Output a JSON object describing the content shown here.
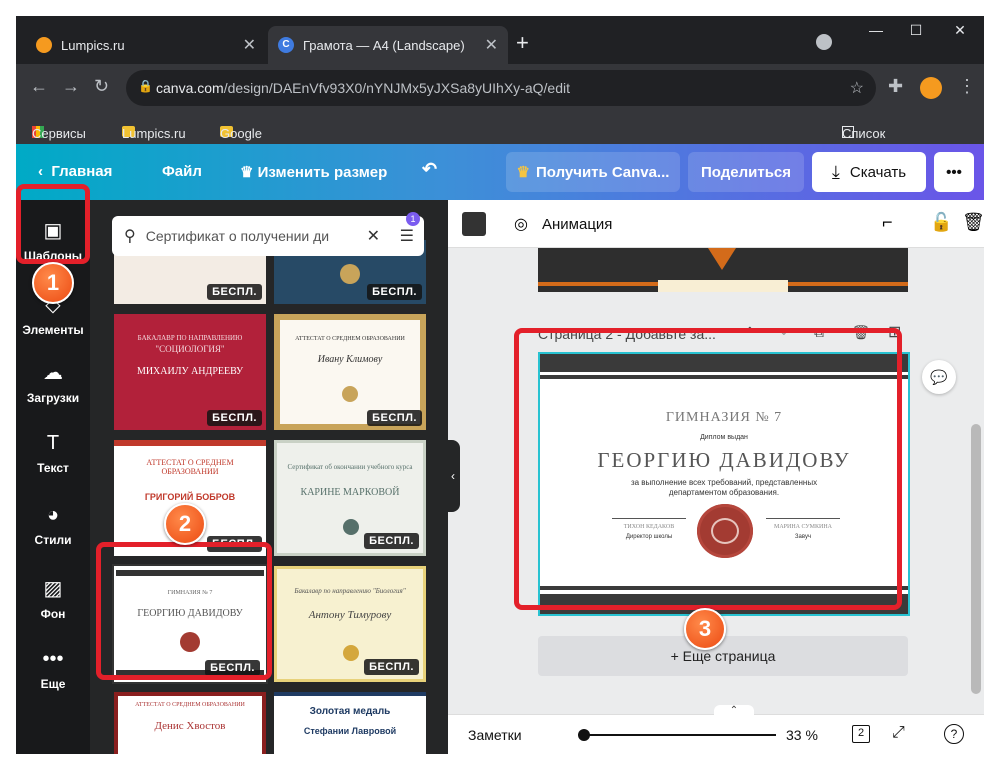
{
  "browser": {
    "tabs": [
      {
        "title": "Lumpics.ru"
      },
      {
        "title": "Грамота — A4 (Landscape)"
      }
    ],
    "new_tab": "+",
    "url_domain": "canva.com",
    "url_path": "/design/DAEnVfv93X0/nYNJMx5yJXSa8yUIhXy-aQ/edit",
    "bookmarks": [
      "Сервисы",
      "Lumpics.ru",
      "Google"
    ],
    "reading_list": "Список для чтения"
  },
  "topbar": {
    "home": "Главная",
    "file": "Файл",
    "resize": "Изменить размер",
    "get_pro": "Получить Canva...",
    "share": "Поделиться",
    "download": "Скачать",
    "more": "•••"
  },
  "sidebar": {
    "items": [
      {
        "label": "Шаблоны"
      },
      {
        "label": "Элементы"
      },
      {
        "label": "Загрузки"
      },
      {
        "label": "Текст"
      },
      {
        "label": "Стили"
      },
      {
        "label": "Фон"
      },
      {
        "label": "Еще"
      }
    ]
  },
  "search": {
    "value": "Сертификат о получении ди",
    "filter_count": "1"
  },
  "badge": "БЕСПЛ.",
  "templates": {
    "t1_name": "МИХАИЛУ АНДРЕЕВУ",
    "t1_top": "БАКАЛАВР ПО НАПРАВЛЕНИЮ",
    "t1_sub": "\"СОЦИОЛОГИЯ\"",
    "t2_head": "АТТЕСТАТ О СРЕДНЕМ ОБРАЗОВАНИИ",
    "t2_name": "Ивану Климову",
    "t3_head": "АТТЕСТАТ О СРЕДНЕМ ОБРАЗОВАНИИ",
    "t3_name": "ГРИГОРИЙ БОБРОВ",
    "t4_head": "Сертификат об окончании учебного курса",
    "t4_name": "КАРИНЕ МАРКОВОЙ",
    "t5_school": "ГИМНАЗИЯ № 7",
    "t5_name": "ГЕОРГИЮ ДАВИДОВУ",
    "t6_head": "Бакалавр по направлению \"Биология\"",
    "t6_name": "Антону Тимурову",
    "t7_head": "АТТЕСТАТ О СРЕДНЕМ ОБРАЗОВАНИИ",
    "t7_name": "Денис Хвостов",
    "t8_head": "Золотая медаль",
    "t8_name": "Стефании Лавровой"
  },
  "canvas": {
    "animation": "Анимация",
    "page2_title": "Страница 2 - Добавьте за...",
    "add_page": "+ Еще страница",
    "notes": "Заметки",
    "zoom": "33 %",
    "pages": "2",
    "help": "?"
  },
  "certificate": {
    "school": "ГИМНАЗИЯ № 7",
    "diploma": "Диплом выдан",
    "name": "ГЕОРГИЮ ДАВИДОВУ",
    "text": "за выполнение всех требований, представленных департаментом образования.",
    "left_name": "ТИХОН КЕДАКОВ",
    "left_role": "Директор школы",
    "right_name": "МАРИНА СУМКИНА",
    "right_role": "Завуч"
  },
  "callouts": [
    "1",
    "2",
    "3"
  ],
  "colors": {
    "accent": "#e3202a",
    "callout": "#ec4a12",
    "canva_purple": "#7b5cf0"
  }
}
